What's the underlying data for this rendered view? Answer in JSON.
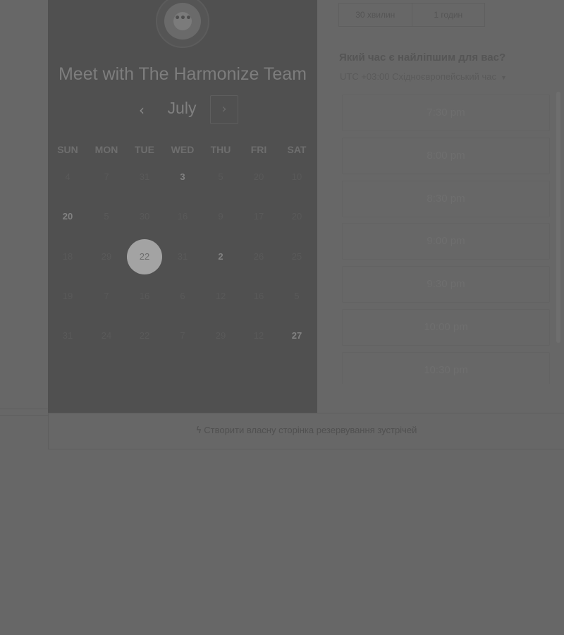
{
  "calendar": {
    "icon": "chat-bubble-icon",
    "title": "Meet with The Harmonize Team",
    "month": "July",
    "prev_label": "‹",
    "next_label": "›",
    "weekdays": [
      "SUN",
      "MON",
      "TUE",
      "WED",
      "THU",
      "FRI",
      "SAT"
    ],
    "weeks": [
      [
        {
          "d": "4"
        },
        {
          "d": "7"
        },
        {
          "d": "31"
        },
        {
          "d": "3",
          "bold": true
        },
        {
          "d": "5"
        },
        {
          "d": "20"
        },
        {
          "d": "10"
        }
      ],
      [
        {
          "d": "20",
          "bold": true
        },
        {
          "d": "5"
        },
        {
          "d": "30"
        },
        {
          "d": "16"
        },
        {
          "d": "9"
        },
        {
          "d": "17"
        },
        {
          "d": "20"
        }
      ],
      [
        {
          "d": "18"
        },
        {
          "d": "29"
        },
        {
          "d": "22",
          "selected": true
        },
        {
          "d": "31"
        },
        {
          "d": "2",
          "bold": true
        },
        {
          "d": "26"
        },
        {
          "d": "25"
        }
      ],
      [
        {
          "d": "19"
        },
        {
          "d": "7"
        },
        {
          "d": "16"
        },
        {
          "d": "6"
        },
        {
          "d": "12"
        },
        {
          "d": "16"
        },
        {
          "d": "5"
        }
      ],
      [
        {
          "d": "31"
        },
        {
          "d": "24"
        },
        {
          "d": "22"
        },
        {
          "d": "7"
        },
        {
          "d": "29"
        },
        {
          "d": "12"
        },
        {
          "d": "27",
          "bold": true
        }
      ]
    ]
  },
  "durations": [
    "30 хвилин",
    "1 годин"
  ],
  "booking": {
    "question": "Який час є найліпшим для вас?",
    "timezone": "UTC +03:00 Східноєвропейський час",
    "slots": [
      "7:30 pm",
      "8:00 pm",
      "8:30 pm",
      "9:00 pm",
      "9:30 pm",
      "10:00 pm",
      "10:30 pm"
    ]
  },
  "footer": {
    "icon": "sprocket-icon",
    "link": "Створити власну сторінка резервування зустрічей"
  }
}
